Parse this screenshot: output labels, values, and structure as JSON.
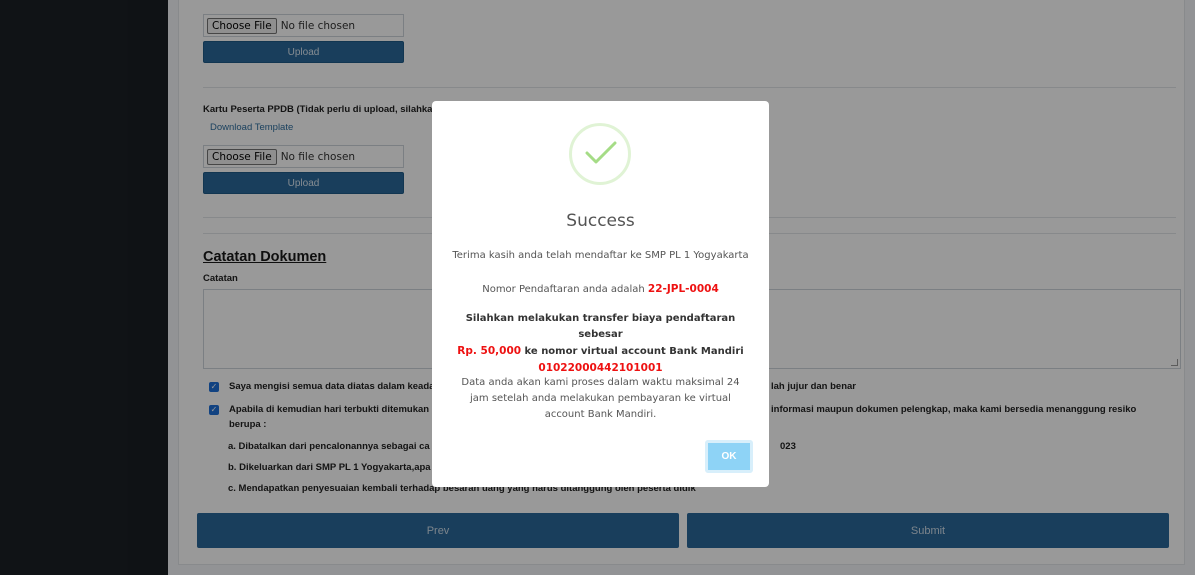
{
  "upload_section_1": {
    "choose_file_label": "Choose File",
    "file_status": "No file chosen",
    "upload_label": "Upload"
  },
  "kartu_section": {
    "label": "Kartu Peserta PPDB (Tidak perlu di upload, silahkan",
    "download_template": "Download Template",
    "choose_file_label": "Choose File",
    "file_status": "No file chosen",
    "upload_label": "Upload"
  },
  "catatan": {
    "section_title": "Catatan Dokumen",
    "field_label": "Catatan",
    "value": ""
  },
  "declarations": {
    "item1_left": "Saya mengisi semua data diatas dalam keadaa",
    "item1_right": "lah jujur dan benar",
    "item2_left": "Apabila di kemudian hari terbukti ditemukan",
    "item2_right": "informasi maupun dokumen pelengkap, maka kami bersedia menanggung resiko",
    "item2_cont": "berupa :",
    "sub_a_left": "a.  Dibatalkan dari pencalonannya sebagai ca",
    "sub_a_right": "023",
    "sub_b": "b.  Dikeluarkan dari SMP PL 1 Yogyakarta,apa",
    "sub_c": "c.  Mendapatkan penyesuaian kembali terhadap besaran uang yang harus ditanggung oleh peserta didik"
  },
  "nav": {
    "prev_label": "Prev",
    "submit_label": "Submit"
  },
  "modal": {
    "icon": "success-check-icon",
    "title": "Success",
    "line_thanks": "Terima kasih anda telah mendaftar ke SMP PL 1 Yogyakarta",
    "reg_prefix": "Nomor Pendaftaran anda adalah ",
    "reg_number": "22-JPL-0004",
    "transfer_line1": "Silahkan melakukan transfer biaya pendaftaran sebesar",
    "amount": "Rp. 50,000",
    "transfer_line2": " ke nomor virtual account Bank Mandiri",
    "va_number": "01022000442101001",
    "process_text": "Data anda akan kami proses dalam waktu maksimal 24 jam setelah anda melakukan pembayaran ke virtual account Bank Mandiri.",
    "ok_label": "OK"
  },
  "colors": {
    "sidebar": "#1a1f24",
    "primary_button": "#2a6899",
    "highlight_red": "#ee1111",
    "ok_button": "#8ed3f6",
    "success_green": "#a5dc86"
  }
}
